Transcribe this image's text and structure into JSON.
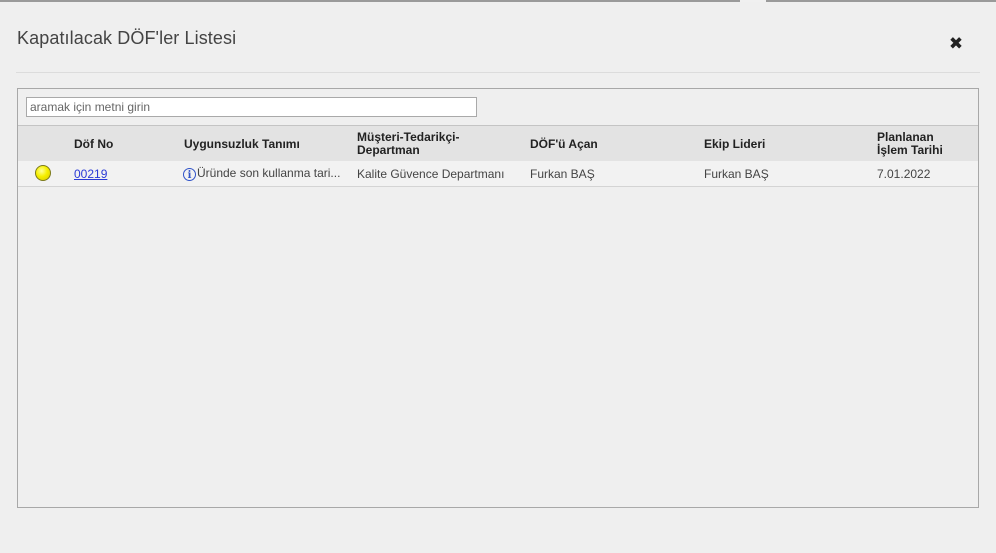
{
  "dialog": {
    "title": "Kapatılacak DÖF'ler Listesi",
    "close_symbol": "✖"
  },
  "search": {
    "placeholder": "aramak için metni girin",
    "value": ""
  },
  "table": {
    "columns": [
      {
        "label": "Döf No"
      },
      {
        "label": "Uygunsuzluk Tanımı"
      },
      {
        "label": "Müşteri-Tedarikçi-Departman"
      },
      {
        "label": "DÖF'ü Açan"
      },
      {
        "label": "Ekip Lideri"
      },
      {
        "label": "Planlanan İşlem Tarihi"
      }
    ],
    "rows": [
      {
        "status_color": "#f6f000",
        "dof_no": "00219",
        "info_icon": "info-icon",
        "description": "Üründe son kullanma tari...",
        "department": "Kalite Güvence Departmanı",
        "opened_by": "Furkan BAŞ",
        "team_leader": "Furkan BAŞ",
        "planned_date": "7.01.2022"
      }
    ]
  }
}
